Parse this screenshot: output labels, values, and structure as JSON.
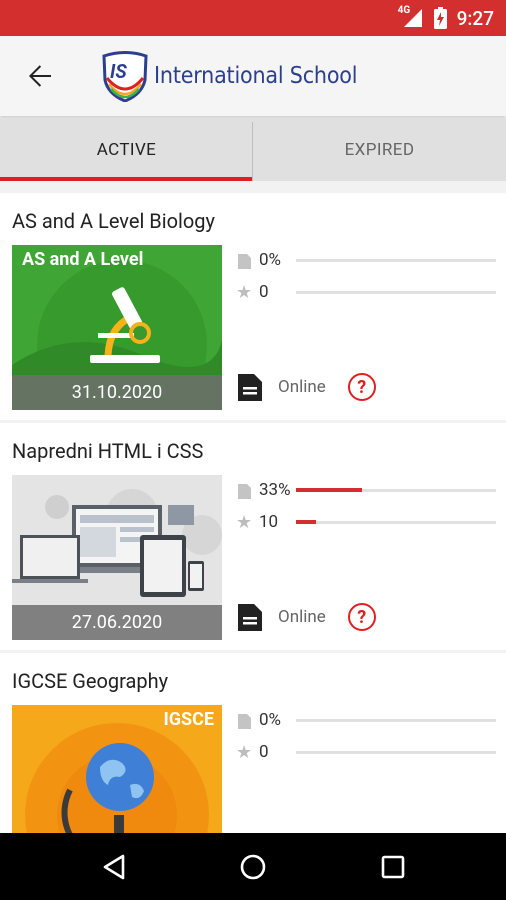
{
  "status_bar": {
    "network": "4G",
    "time": "9:27"
  },
  "app_bar": {
    "logo_mark": "IS",
    "logo_text": "International School"
  },
  "tabs": [
    {
      "label": "ACTIVE"
    },
    {
      "label": "EXPIRED"
    }
  ],
  "courses": [
    {
      "title": "AS and A Level Biology",
      "thumb_label": "AS and A Level",
      "date": "31.10.2020",
      "progress_text": "0%",
      "progress": 0,
      "score_text": "0",
      "score": 0,
      "mode": "Online",
      "help": "?"
    },
    {
      "title": "Napredni HTML i CSS",
      "date": "27.06.2020",
      "progress_text": "33%",
      "progress": 0.33,
      "score_text": "10",
      "score": 0.1,
      "mode": "Online",
      "help": "?"
    },
    {
      "title": "IGCSE Geography",
      "thumb_label": "IGSCE",
      "progress_text": "0%",
      "progress": 0,
      "score_text": "0",
      "score": 0
    }
  ],
  "colors": {
    "primary": "#d32f2f",
    "accent": "#e02020",
    "logo_blue": "#2b3f8f"
  }
}
